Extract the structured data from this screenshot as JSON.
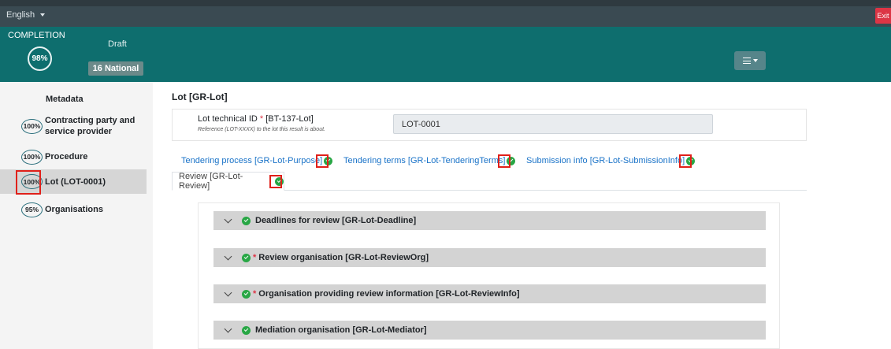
{
  "topbar": {
    "language": "English",
    "exit_label": "Exit"
  },
  "header": {
    "completion_label": "COMPLETION",
    "completion_value": "98%",
    "status": "Draft",
    "notice_type": "16 National"
  },
  "sidebar": {
    "title": "Metadata",
    "items": [
      {
        "pct": "100%",
        "label": "Contracting party and service provider"
      },
      {
        "pct": "100%",
        "label": "Procedure"
      },
      {
        "pct": "100%",
        "label": "Lot (LOT-0001)"
      },
      {
        "pct": "95%",
        "label": "Organisations"
      }
    ]
  },
  "main": {
    "title": "Lot [GR-Lot]",
    "lot_id": {
      "label": "Lot technical ID",
      "required_mark": "*",
      "code": "[BT-137-Lot]",
      "help": "Reference (LOT-XXXX) to the lot this result is about.",
      "value": "LOT-0001"
    },
    "tabs": [
      {
        "label": "Tendering process  [GR-Lot-Purpose]"
      },
      {
        "label": "Tendering terms  [GR-Lot-TenderingTerms]"
      },
      {
        "label": "Submission info  [GR-Lot-SubmissionInfo]"
      },
      {
        "label": "Review  [GR-Lot-Review]"
      }
    ],
    "sections": [
      {
        "label": "Deadlines for review  [GR-Lot-Deadline]",
        "required": ""
      },
      {
        "label": "Review organisation  [GR-Lot-ReviewOrg]",
        "required": "*"
      },
      {
        "label": "Organisation providing review information  [GR-Lot-ReviewInfo]",
        "required": "*"
      },
      {
        "label": "Mediation organisation  [GR-Lot-Mediator]",
        "required": ""
      }
    ]
  },
  "colors": {
    "header_teal": "#0e6e6e",
    "topbar": "#3a4a52",
    "valid_green": "#28a745",
    "link_blue": "#1a73c8",
    "highlight_red": "#e0201a",
    "exit_red": "#dc3545"
  }
}
